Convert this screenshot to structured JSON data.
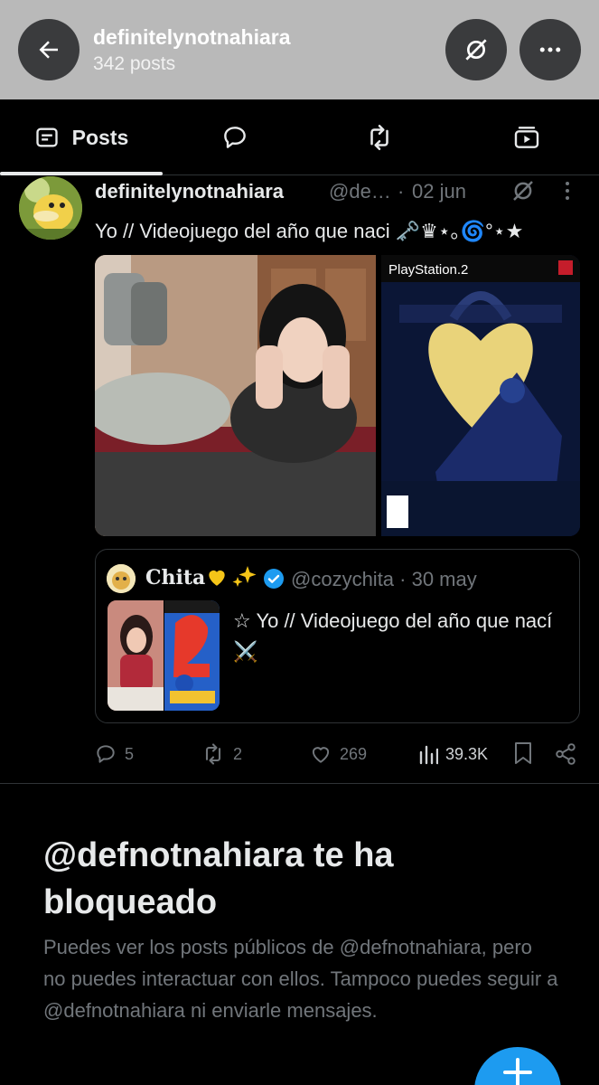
{
  "header": {
    "title": "definitelynotnahiara",
    "subtitle": "342 posts"
  },
  "tabs": {
    "posts_label": "Posts"
  },
  "tweet": {
    "name": "definitelynotnahiara",
    "handle": "@de…",
    "separator": "·",
    "date": "02 jun",
    "text": "Yo // Videojuego del año que naci 🗝️♛⋆｡🌀°⋆★",
    "ps2_label": "PlayStation.2",
    "quote": {
      "name": "Chita",
      "handle_date": "@cozychita · 30 may",
      "text": "☆ Yo // Videojuego del año que nací ⚔️"
    },
    "actions": {
      "replies": "5",
      "reposts": "2",
      "likes": "269",
      "views": "39.3K"
    }
  },
  "blocked": {
    "title": "@defnotnahiara te ha bloqueado",
    "description": "Puedes ver los posts públicos de @defnotnahiara, pero no puedes interactuar con ellos. Tampoco puedes seguir a @defnotnahiara ni enviarle mensajes."
  },
  "colors": {
    "accent": "#1d9bf0",
    "background": "#000000",
    "muted_text": "#71767b",
    "text": "#e7e9ea",
    "header_bg": "#b9b9b9"
  }
}
